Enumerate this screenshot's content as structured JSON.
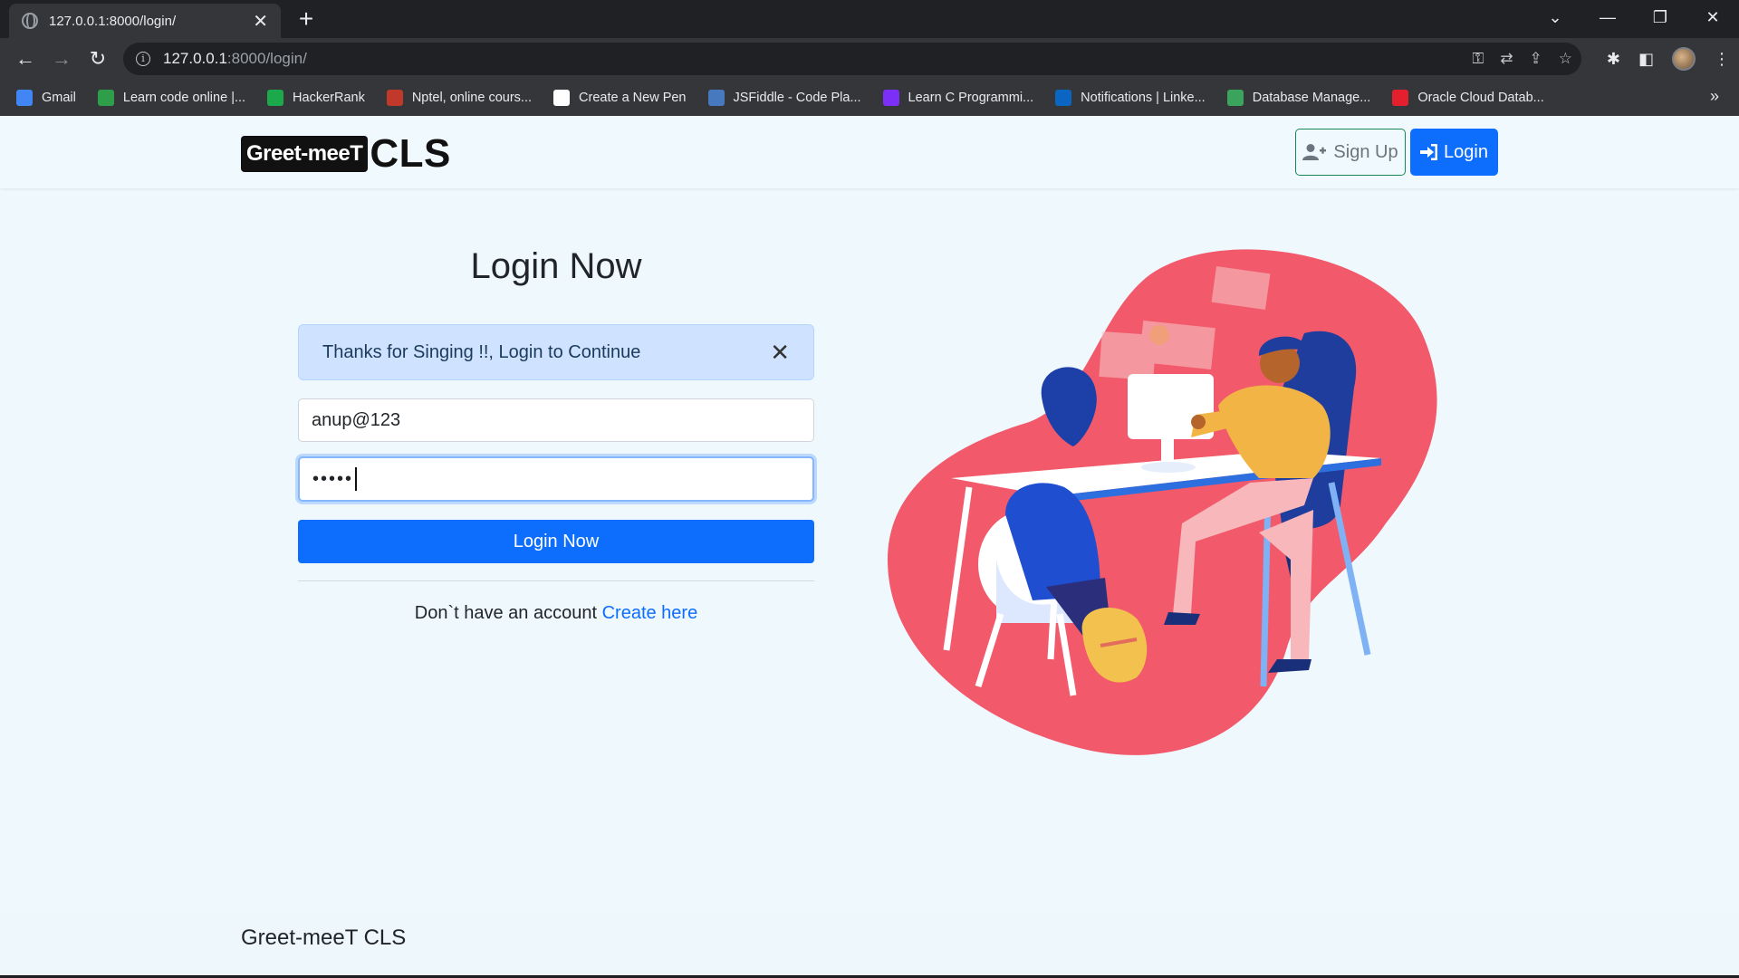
{
  "browser": {
    "tab_title": "127.0.0.1:8000/login/",
    "url_host": "127.0.0.1",
    "url_path": ":8000/login/",
    "bookmarks": [
      {
        "label": "Gmail",
        "color": "#4285f4"
      },
      {
        "label": "Learn code online |...",
        "color": "#2e9e4a"
      },
      {
        "label": "HackerRank",
        "color": "#1ba94c"
      },
      {
        "label": "Nptel, online cours...",
        "color": "#c0392b"
      },
      {
        "label": "Create a New Pen",
        "color": "#ffffff"
      },
      {
        "label": "JSFiddle - Code Pla...",
        "color": "#4679bd"
      },
      {
        "label": "Learn C Programmi...",
        "color": "#7b2ff7"
      },
      {
        "label": "Notifications | Linke...",
        "color": "#0a66c2"
      },
      {
        "label": "Database Manage...",
        "color": "#3aa35c"
      },
      {
        "label": "Oracle Cloud Datab...",
        "color": "#e4202e"
      }
    ]
  },
  "site": {
    "logo_badge": "Greet-meeT",
    "logo_suffix": "CLS",
    "signup_label": "Sign Up",
    "login_label": "Login"
  },
  "login": {
    "title": "Login Now",
    "alert": "Thanks for Singing !!, Login to Continue",
    "username_value": "anup@123",
    "password_mask": "•••••",
    "submit_label": "Login Now",
    "no_account_text": "Don`t have an account",
    "create_link": "Create here"
  },
  "footer": {
    "brand": "Greet-meeT CLS"
  },
  "colors": {
    "primary": "#0d6efd",
    "success_outline": "#198754",
    "alert_bg": "#cfe2ff",
    "page_bg": "#eef8fd",
    "blob": "#f25a6b"
  }
}
